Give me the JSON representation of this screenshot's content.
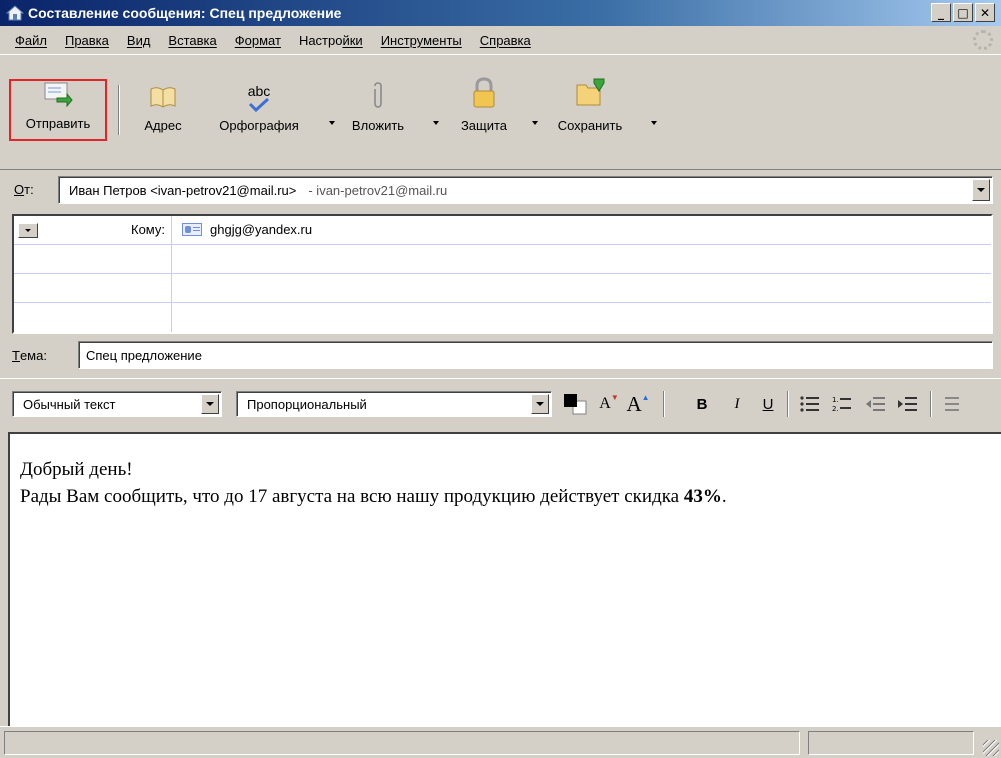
{
  "window": {
    "title": "Составление сообщения: Спец предложение",
    "buttons": {
      "minimize": "_",
      "maximize": "□",
      "close": "✕"
    }
  },
  "menu": [
    {
      "first": "Ф",
      "rest": "айл"
    },
    {
      "first": "П",
      "rest": "равка"
    },
    {
      "first": "В",
      "rest": "ид"
    },
    {
      "first": "В",
      "rest": "ставка"
    },
    {
      "first": "Ф",
      "rest": "ормат"
    },
    {
      "first": "Настро",
      "rest": "йки"
    },
    {
      "first": "И",
      "rest": "нструменты"
    },
    {
      "first": "С",
      "rest": "правка"
    }
  ],
  "toolbar": {
    "send": "Отправить",
    "address": "Адрес",
    "spelling": "Орфография",
    "spelling_icon_text": "abc",
    "attach": "Вложить",
    "security": "Защита",
    "save": "Сохранить"
  },
  "from": {
    "label_first": "О",
    "label_rest": "т:",
    "value": "Иван Петров <ivan-petrov21@mail.ru>",
    "account": "- ivan-petrov21@mail.ru"
  },
  "recipients": {
    "type_label": "Кому:",
    "address": "ghgjg@yandex.ru"
  },
  "subject": {
    "label_first": "Т",
    "label_rest": "ема:",
    "value": "Спец предложение"
  },
  "format": {
    "paragraph_style": "Обычный текст",
    "font": "Пропорциональный",
    "smaller": "A",
    "larger": "A",
    "bold": "B",
    "italic": "I",
    "underline": "U"
  },
  "body": {
    "line1": "Добрый день!",
    "line2_pre": "Рады Вам сообщить, что до 17 августа на всю нашу продукцию действует скидка ",
    "line2_bold": "43%",
    "line2_post": "."
  },
  "colors": {
    "send_highlight": "#e0262b",
    "titlebar_start": "#0a246a",
    "titlebar_end": "#a6caf0",
    "window_bg": "#d4d0c8"
  }
}
